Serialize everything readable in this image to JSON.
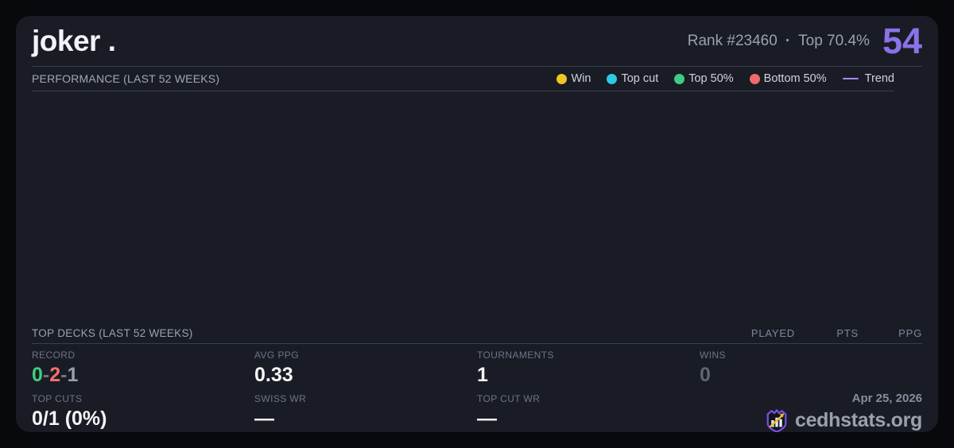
{
  "player": {
    "name": "joker .",
    "rank_label": "Rank #23460",
    "separator": "·",
    "top_percent_label": "Top 70.4%",
    "score": "54",
    "score_color": "#8b72e8"
  },
  "performance": {
    "title": "PERFORMANCE (LAST 52 WEEKS)",
    "legend": [
      {
        "label": "Win",
        "color": "#f2c522"
      },
      {
        "label": "Top cut",
        "color": "#2ec9e2"
      },
      {
        "label": "Top 50%",
        "color": "#3ecb82"
      },
      {
        "label": "Bottom 50%",
        "color": "#ef6b6b"
      }
    ],
    "trend": {
      "label": "Trend",
      "color": "#a78bfa"
    }
  },
  "chart_data": {
    "type": "scatter",
    "title": "PERFORMANCE (LAST 52 WEEKS)",
    "series": [
      {
        "name": "Win",
        "points": []
      },
      {
        "name": "Top cut",
        "points": []
      },
      {
        "name": "Top 50%",
        "points": []
      },
      {
        "name": "Bottom 50%",
        "points": []
      },
      {
        "name": "Trend",
        "points": []
      }
    ],
    "legend_position": "top-right",
    "grid": false,
    "note": "chart area rendered empty - no data points visible"
  },
  "top_decks": {
    "title": "TOP DECKS (LAST 52 WEEKS)",
    "columns": [
      "PLAYED",
      "PTS",
      "PPG"
    ],
    "rows": []
  },
  "stats": {
    "record": {
      "label": "RECORD",
      "wins": "0",
      "losses": "2",
      "draws": "1",
      "sep": "-",
      "wins_color": "#3ecf7f",
      "losses_color": "#f17070",
      "draws_color": "#9aa0ab",
      "sep_color": "#6f7582"
    },
    "avg_ppg": {
      "label": "AVG PPG",
      "value": "0.33"
    },
    "tournaments": {
      "label": "TOURNAMENTS",
      "value": "1"
    },
    "wins": {
      "label": "WINS",
      "value": "0"
    },
    "top_cuts": {
      "label": "TOP CUTS",
      "value": "0/1 (0%)"
    },
    "swiss_wr": {
      "label": "SWISS WR",
      "value": "—"
    },
    "top_cut_wr": {
      "label": "TOP CUT WR",
      "value": "—"
    }
  },
  "footer": {
    "date": "Apr 25, 2026",
    "brand": "cedhstats.org",
    "logo_accent": "#7a4fe0",
    "logo_arrow": "#ecba3a"
  }
}
